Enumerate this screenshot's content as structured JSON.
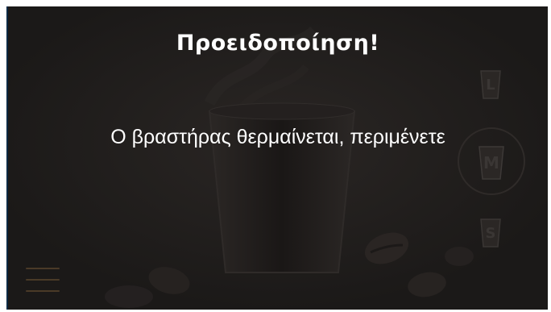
{
  "dialog": {
    "title": "Προειδοποίηση!",
    "message": "Ο βραστήρας θερμαίνεται, περιμένετε"
  },
  "size_buttons": {
    "large": "L",
    "medium": "M",
    "small": "S",
    "selected": "M"
  },
  "menu": {
    "icon": "hamburger-menu-icon"
  },
  "colors": {
    "background": "#1f1c1b",
    "text": "#ffffff",
    "menu_icon": "#4a3a27"
  }
}
